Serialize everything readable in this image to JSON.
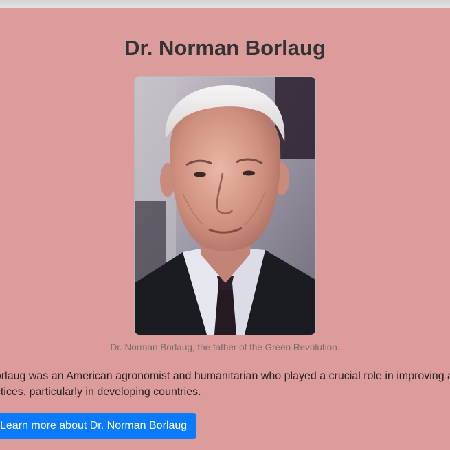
{
  "page": {
    "title": "Dr. Norman Borlaug"
  },
  "portrait": {
    "alt": "Dr. Norman Borlaug",
    "caption": "Dr. Norman Borlaug, the father of the Green Revolution."
  },
  "bio": {
    "line1": "Dr. Norman Borlaug was an American agronomist and humanitarian who played a crucial role in improving agricultural",
    "line2": "agricultural practices, particularly in developing countries."
  },
  "cta": {
    "label": "Learn more about Dr. Norman Borlaug"
  },
  "colors": {
    "background": "#dc9c9c",
    "button": "#0a7bff",
    "title": "#333333",
    "caption": "#7b6b6b"
  }
}
